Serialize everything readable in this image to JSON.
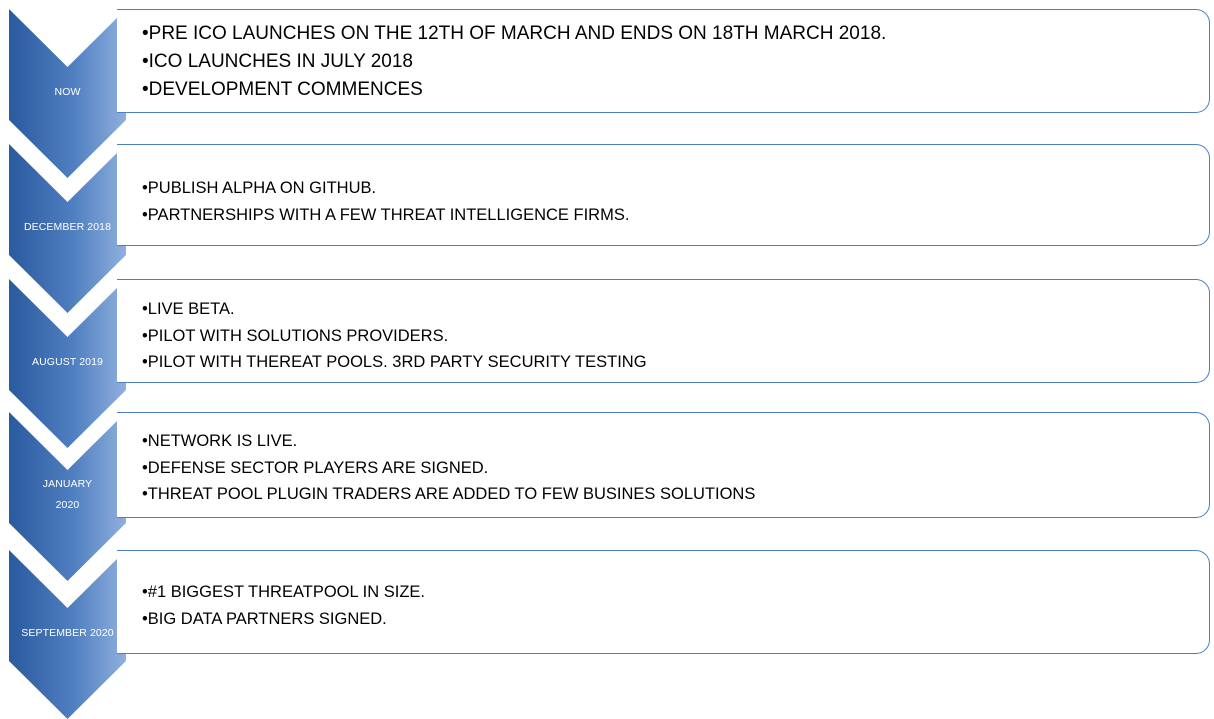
{
  "colors": {
    "chevron_dark": "#2a5a9e",
    "chevron_mid": "#4f7fc0",
    "chevron_light": "#8fb0de",
    "box_border": "#4f7fc0",
    "label_text": "#ffffff",
    "body_text": "#000000"
  },
  "stages": [
    {
      "label": "NOW",
      "items": [
        "•PRE ICO LAUNCHES ON THE 12TH OF MARCH AND ENDS ON 18TH MARCH 2018.",
        "•ICO LAUNCHES IN JULY 2018",
        "•DEVELOPMENT COMMENCES"
      ]
    },
    {
      "label": "DECEMBER 2018",
      "items": [
        "•PUBLISH ALPHA ON GITHUB.",
        "•PARTNERSHIPS WITH A FEW THREAT INTELLIGENCE FIRMS."
      ]
    },
    {
      "label": "AUGUST 2019",
      "items": [
        "•LIVE BETA.",
        "•PILOT WITH SOLUTIONS PROVIDERS.",
        "•PILOT WITH THEREAT POOLS. 3RD PARTY SECURITY TESTING"
      ]
    },
    {
      "label": "JANUARY\n2020",
      "items": [
        "•NETWORK IS LIVE.",
        "•DEFENSE SECTOR PLAYERS ARE SIGNED.",
        "•THREAT POOL PLUGIN TRADERS ARE ADDED TO FEW BUSINES SOLUTIONS"
      ]
    },
    {
      "label": "SEPTEMBER 2020",
      "items": [
        "•#1 BIGGEST THREATPOOL IN SIZE.",
        "•BIG DATA PARTNERS SIGNED."
      ]
    }
  ]
}
